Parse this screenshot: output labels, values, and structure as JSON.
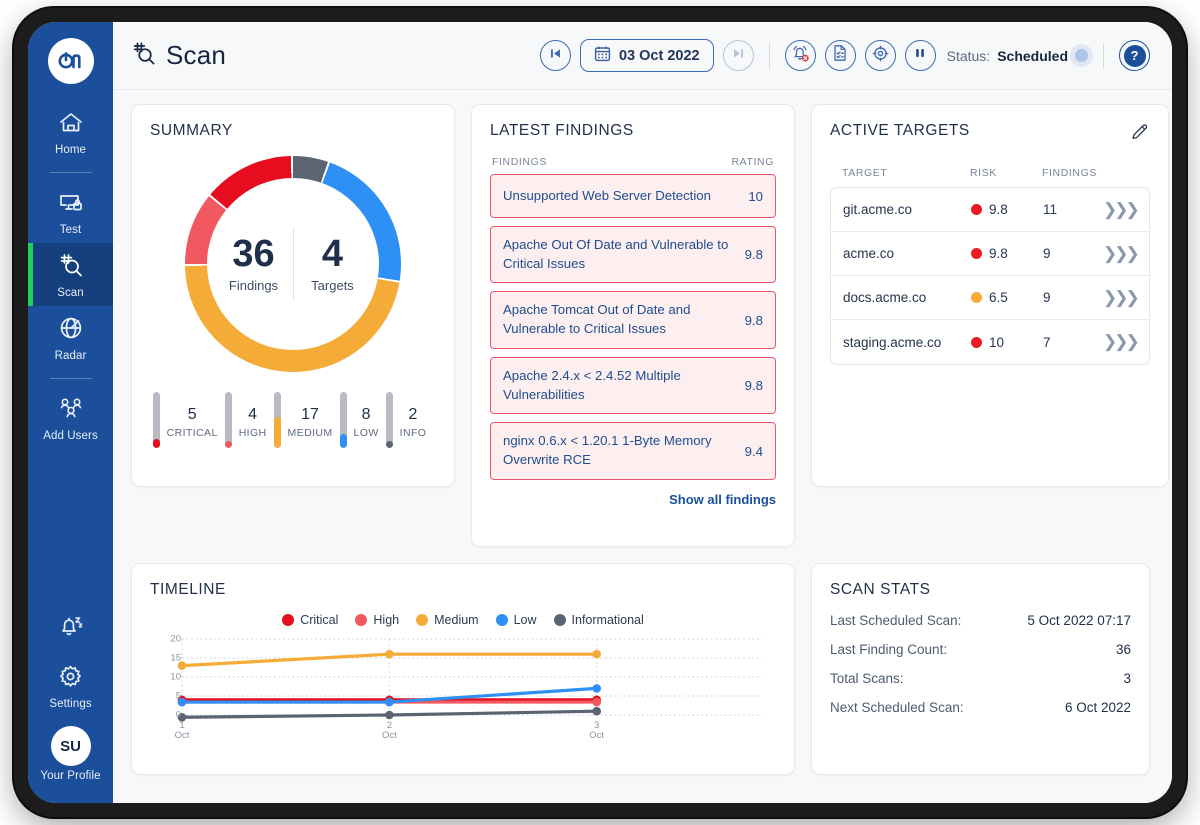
{
  "brand": {
    "logo_text": "on"
  },
  "sidebar": {
    "items": [
      {
        "label": "Home",
        "icon": "home-icon",
        "active": false
      },
      {
        "label": "Test",
        "icon": "monitor-lock-icon",
        "active": false
      },
      {
        "label": "Scan",
        "icon": "scan-magnifier-icon",
        "active": true
      },
      {
        "label": "Radar",
        "icon": "radar-globe-icon",
        "active": false
      },
      {
        "label": "Add Users",
        "icon": "add-users-icon",
        "active": false
      }
    ],
    "bottom": {
      "notifications_icon": "bell-snooze-icon",
      "settings_label": "Settings",
      "settings_icon": "gear-icon",
      "profile_initials": "SU",
      "profile_label": "Your Profile"
    }
  },
  "header": {
    "title": "Scan",
    "title_icon": "scan-magnifier-icon",
    "prev_icon": "skip-back-icon",
    "next_icon": "skip-forward-icon",
    "date": "03 Oct 2022",
    "calendar_icon": "calendar-icon",
    "actions": [
      {
        "icon": "alarm-off-icon",
        "name": "alert-mute-button"
      },
      {
        "icon": "report-icon",
        "name": "report-button"
      },
      {
        "icon": "target-icon",
        "name": "targets-button"
      },
      {
        "icon": "pause-icon",
        "name": "pause-scan-button"
      }
    ],
    "status_label": "Status:",
    "status_value": "Scheduled",
    "help_icon": "question-mark-icon"
  },
  "summary": {
    "title": "SUMMARY",
    "findings_count": "36",
    "findings_label": "Findings",
    "targets_count": "4",
    "targets_label": "Targets",
    "severities": [
      {
        "label": "CRITICAL",
        "count": "5",
        "value": 5,
        "color": "#e60d1e"
      },
      {
        "label": "HIGH",
        "count": "4",
        "value": 4,
        "color": "#f2585f"
      },
      {
        "label": "MEDIUM",
        "count": "17",
        "value": 17,
        "color": "#f5ab38"
      },
      {
        "label": "LOW",
        "count": "8",
        "value": 8,
        "color": "#2e90f5"
      },
      {
        "label": "INFO",
        "count": "2",
        "value": 2,
        "color": "#5a6472"
      }
    ]
  },
  "latest_findings": {
    "title": "LATEST FINDINGS",
    "col_findings": "FINDINGS",
    "col_rating": "RATING",
    "rows": [
      {
        "name": "Unsupported Web Server Detection",
        "rating": "10"
      },
      {
        "name": "Apache Out Of Date and Vulnerable to Critical Issues",
        "rating": "9.8"
      },
      {
        "name": "Apache Tomcat Out of Date and Vulnerable to Critical Issues",
        "rating": "9.8"
      },
      {
        "name": "Apache 2.4.x < 2.4.52 Multiple Vulnerabilities",
        "rating": "9.8"
      },
      {
        "name": "nginx 0.6.x < 1.20.1 1-Byte Memory Overwrite RCE",
        "rating": "9.4"
      }
    ],
    "show_all": "Show all findings"
  },
  "active_targets": {
    "title": "ACTIVE TARGETS",
    "edit_icon": "pencil-icon",
    "col_target": "TARGET",
    "col_risk": "RISK",
    "col_findings": "FINDINGS",
    "rows": [
      {
        "target": "git.acme.co",
        "risk": "9.8",
        "risk_color": "#ea1b23",
        "findings": "11"
      },
      {
        "target": "acme.co",
        "risk": "9.8",
        "risk_color": "#ea1b23",
        "findings": "9"
      },
      {
        "target": "docs.acme.co",
        "risk": "6.5",
        "risk_color": "#f5ab38",
        "findings": "9"
      },
      {
        "target": "staging.acme.co",
        "risk": "10",
        "risk_color": "#ea1b23",
        "findings": "7"
      }
    ]
  },
  "timeline": {
    "title": "TIMELINE"
  },
  "chart_data": {
    "type": "line",
    "title": "TIMELINE",
    "x": [
      "1\nOct",
      "2\nOct",
      "3\nOct"
    ],
    "x_tick_day": [
      "1",
      "2",
      "3"
    ],
    "x_tick_month": [
      "Oct",
      "Oct",
      "Oct"
    ],
    "xlabel": "",
    "ylabel": "",
    "ylim": [
      0,
      20
    ],
    "yticks": [
      0,
      5,
      10,
      15,
      20
    ],
    "grid": true,
    "legend_position": "top-center",
    "series": [
      {
        "name": "Critical",
        "color": "#e60d1e",
        "values": [
          4,
          4,
          4
        ]
      },
      {
        "name": "High",
        "color": "#f2585f",
        "values": [
          3.4,
          3.4,
          3.4
        ]
      },
      {
        "name": "Medium",
        "color": "#f5ab38",
        "values": [
          13,
          16,
          16
        ]
      },
      {
        "name": "Low",
        "color": "#2e90f5",
        "values": [
          3.4,
          3.4,
          7
        ]
      },
      {
        "name": "Informational",
        "color": "#5a6472",
        "values": [
          -0.6,
          0,
          1
        ]
      }
    ]
  },
  "scan_stats": {
    "title": "SCAN STATS",
    "rows": [
      {
        "key": "Last Scheduled Scan:",
        "value": "5 Oct 2022 07:17"
      },
      {
        "key": "Last Finding Count:",
        "value": "36"
      },
      {
        "key": "Total Scans:",
        "value": "3"
      },
      {
        "key": "Next Scheduled Scan:",
        "value": "6 Oct 2022"
      }
    ]
  }
}
